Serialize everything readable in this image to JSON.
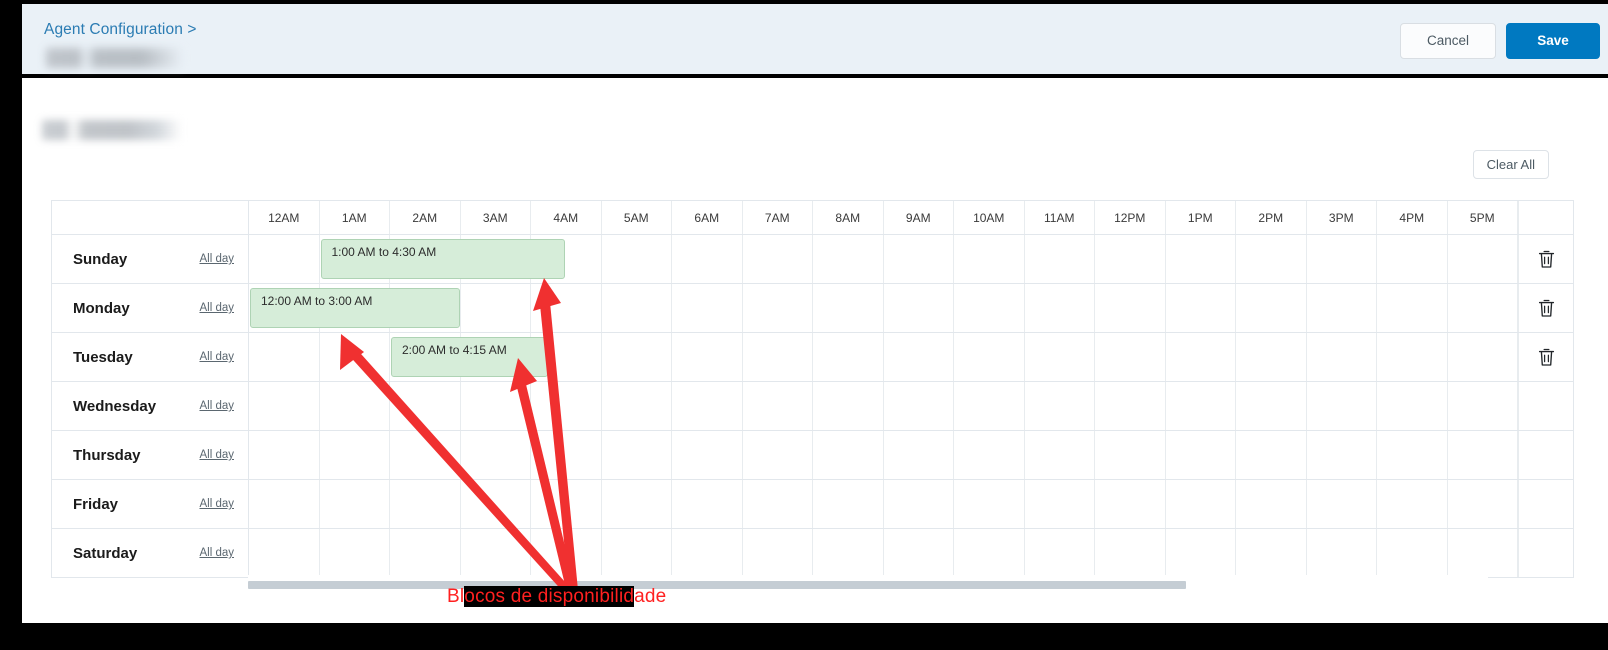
{
  "header": {
    "breadcrumb": "Agent Configuration >",
    "cancel_label": "Cancel",
    "save_label": "Save",
    "accent_blue": "#0079c1"
  },
  "toolbar": {
    "clear_all_label": "Clear All"
  },
  "grid": {
    "corner_label": "",
    "hours": [
      "12AM",
      "1AM",
      "2AM",
      "3AM",
      "4AM",
      "5AM",
      "6AM",
      "7AM",
      "8AM",
      "9AM",
      "10AM",
      "11AM",
      "12PM",
      "1PM",
      "2PM",
      "3PM",
      "4PM",
      "5PM"
    ],
    "all_day_label": "All day",
    "delete_icon": "trash-icon",
    "rows": [
      {
        "day": "Sunday",
        "has_delete": true,
        "blocks": [
          {
            "label": "1:00 AM to 4:30 AM",
            "start_hour": 1.0,
            "end_hour": 4.5
          }
        ]
      },
      {
        "day": "Monday",
        "has_delete": true,
        "blocks": [
          {
            "label": "12:00 AM to 3:00 AM",
            "start_hour": 0.0,
            "end_hour": 3.0
          }
        ]
      },
      {
        "day": "Tuesday",
        "has_delete": true,
        "blocks": [
          {
            "label": "2:00 AM to 4:15 AM",
            "start_hour": 2.0,
            "end_hour": 4.25
          }
        ]
      },
      {
        "day": "Wednesday",
        "has_delete": false,
        "blocks": []
      },
      {
        "day": "Thursday",
        "has_delete": false,
        "blocks": []
      },
      {
        "day": "Friday",
        "has_delete": false,
        "blocks": []
      },
      {
        "day": "Saturday",
        "has_delete": false,
        "blocks": []
      }
    ],
    "block_fill": "#d6edd9",
    "block_border": "#aed3b4"
  },
  "annotation": {
    "text_before": "Bl",
    "text_highlight": "ocos de disponibilid",
    "text_after": "ade",
    "full_text": "Blocos de disponibilidade",
    "color": "#ff2020",
    "arrow_count": 3
  }
}
